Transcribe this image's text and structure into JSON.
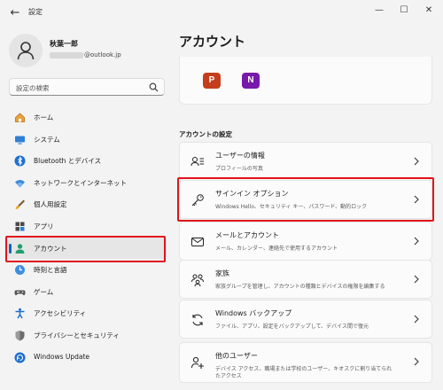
{
  "window": {
    "title": "設定"
  },
  "profile": {
    "name": "秋葉一郎",
    "email_visible": "@outlook.jp"
  },
  "search": {
    "placeholder": "設定の検索"
  },
  "sidebar": {
    "items": [
      {
        "label": "ホーム",
        "icon": "home-icon"
      },
      {
        "label": "システム",
        "icon": "monitor-icon"
      },
      {
        "label": "Bluetooth とデバイス",
        "icon": "bluetooth-icon"
      },
      {
        "label": "ネットワークとインターネット",
        "icon": "wifi-icon"
      },
      {
        "label": "個人用設定",
        "icon": "brush-icon"
      },
      {
        "label": "アプリ",
        "icon": "apps-icon"
      },
      {
        "label": "アカウント",
        "icon": "person-icon",
        "selected": true
      },
      {
        "label": "時刻と言語",
        "icon": "globe-clock-icon"
      },
      {
        "label": "ゲーム",
        "icon": "controller-icon"
      },
      {
        "label": "アクセシビリティ",
        "icon": "accessibility-icon"
      },
      {
        "label": "プライバシーとセキュリティ",
        "icon": "shield-icon"
      },
      {
        "label": "Windows Update",
        "icon": "update-icon"
      }
    ]
  },
  "main": {
    "title": "アカウント",
    "apps": [
      {
        "letter": "P",
        "icon": "powerpoint-icon",
        "color": "#c43e1c"
      },
      {
        "letter": "N",
        "icon": "onenote-icon",
        "color": "#7719aa"
      }
    ],
    "section_title": "アカウントの設定",
    "cards": [
      {
        "title": "ユーザーの情報",
        "desc": "プロフィールの写真",
        "desc2": "",
        "icon": "user-info-icon"
      },
      {
        "title": "サインイン オプション",
        "desc": "Windows Hello、セキュリティ キー、パスワード、動的ロック",
        "desc2": "",
        "icon": "key-icon"
      },
      {
        "title": "メールとアカウント",
        "desc": "メール、カレンダー、連絡先で使用するアカウント",
        "desc2": "",
        "icon": "mail-icon"
      },
      {
        "title": "家族",
        "desc": "家族グループを管理し、アカウントの種類とデバイスの権限を編集する",
        "desc2": "",
        "icon": "family-icon"
      },
      {
        "title": "Windows バックアップ",
        "desc": "ファイル、アプリ、設定をバックアップして、デバイス間で復元",
        "desc2": "",
        "icon": "backup-icon"
      },
      {
        "title": "他のユーザー",
        "desc": "デバイス アクセス、職場または学校のユーザー、キオスクに割り当てられ",
        "desc2": "たアクセス",
        "icon": "other-users-icon"
      }
    ]
  },
  "colors": {
    "accent": "#0067c0",
    "highlight": "#e0141b"
  }
}
